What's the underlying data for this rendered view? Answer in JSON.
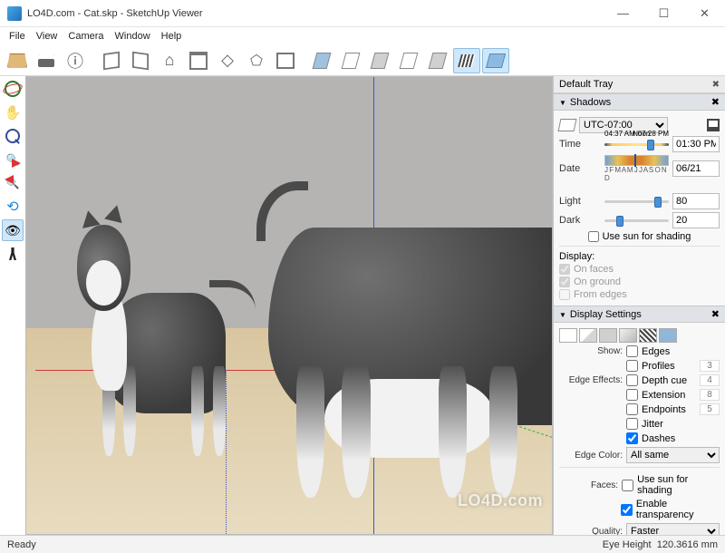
{
  "window": {
    "title": "LO4D.com - Cat.skp - SketchUp Viewer",
    "minimize": "—",
    "maximize": "☐",
    "close": "✕"
  },
  "menu": {
    "items": [
      "File",
      "View",
      "Camera",
      "Window",
      "Help"
    ]
  },
  "toolbar": {
    "items": [
      "open",
      "print",
      "info",
      "iso",
      "top",
      "home",
      "front",
      "back",
      "left",
      "right",
      "style-blue",
      "style-white",
      "style-shaded",
      "style-hidden",
      "style-shaded2",
      "style-mono",
      "style-tex"
    ],
    "active1": "style-mono",
    "active2": "style-tex"
  },
  "left_tools": {
    "items": [
      "orbit",
      "pan",
      "zoom",
      "zoom-extents",
      "zoom-region",
      "zoom-previous",
      "look-around",
      "walk"
    ],
    "active": "look-around"
  },
  "tray": {
    "title": "Default Tray",
    "close": "✖",
    "shadows": {
      "title": "Shadows",
      "timezone": "UTC-07:00",
      "time_label": "Time",
      "time_start": "04:37 AM",
      "time_noon": "Noon",
      "time_end": "07:28 PM",
      "time_value": "01:30 PM",
      "date_label": "Date",
      "months": "J F M A M J J A S O N D",
      "date_value": "06/21",
      "light_label": "Light",
      "light_value": "80",
      "dark_label": "Dark",
      "dark_value": "20",
      "use_sun": "Use sun for shading",
      "display_label": "Display:",
      "on_faces": "On faces",
      "on_ground": "On ground",
      "from_edges": "From edges"
    },
    "display_settings": {
      "title": "Display Settings",
      "show_label": "Show:",
      "edges": "Edges",
      "profiles": "Profiles",
      "profiles_val": "3",
      "effects_label": "Edge Effects:",
      "depth_cue": "Depth cue",
      "depth_cue_val": "4",
      "extension": "Extension",
      "extension_val": "8",
      "endpoints": "Endpoints",
      "endpoints_val": "5",
      "jitter": "Jitter",
      "dashes": "Dashes",
      "edge_color_label": "Edge Color:",
      "edge_color_value": "All same",
      "faces_label": "Faces:",
      "use_sun_faces": "Use sun for shading",
      "enable_trans": "Enable transparency",
      "quality_label": "Quality:",
      "quality_value": "Faster"
    }
  },
  "status": {
    "left": "Ready",
    "right_label": "Eye Height",
    "right_value": "120.3616 mm"
  },
  "watermark": "LO4D.com"
}
